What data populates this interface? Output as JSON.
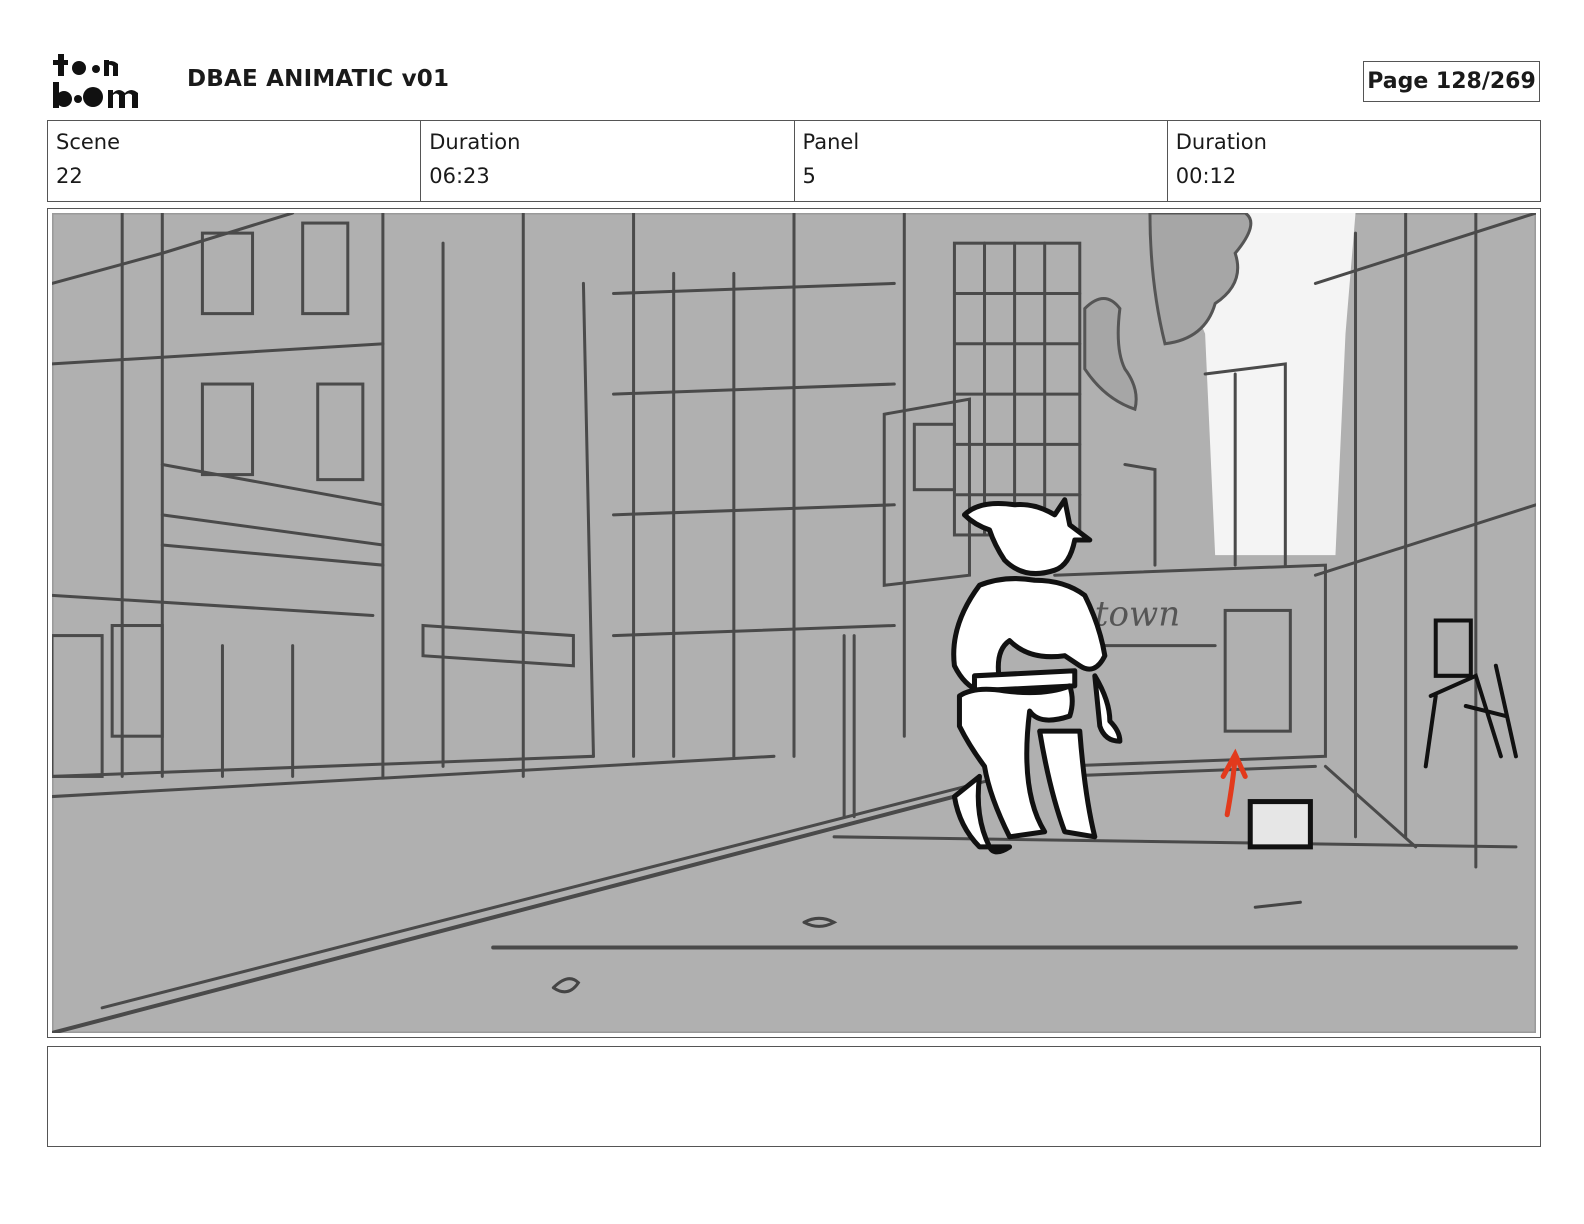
{
  "header": {
    "logo_text": "toon boom",
    "title": "DBAE ANIMATIC v01",
    "page_label": "Page 128/269"
  },
  "info": {
    "scene_label": "Scene",
    "scene_value": "22",
    "scene_duration_label": "Duration",
    "scene_duration_value": "06:23",
    "panel_label": "Panel",
    "panel_value": "5",
    "panel_duration_label": "Duration",
    "panel_duration_value": "00:12"
  },
  "panel_image": {
    "sign_text": "town"
  },
  "notes": {
    "text": ""
  }
}
